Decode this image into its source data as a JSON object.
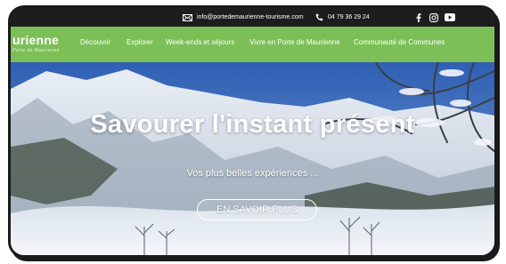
{
  "topbar": {
    "email": "info@portedemaurienne-tourisme.com",
    "phone": "04 79 36 29 24",
    "social_icons": [
      "facebook-icon",
      "instagram-icon",
      "youtube-icon"
    ],
    "background": "#1d1d1d"
  },
  "nav": {
    "logo_text": "urienne",
    "logo_subtext": "Porte de Maurienne",
    "background": "#7cbf57",
    "links": [
      "Découvrir",
      "Explorer",
      "Week-ends et séjours",
      "Vivre en Porte de Maurienne",
      "Communauté de Communes"
    ]
  },
  "hero": {
    "title": "Savourer l'instant présent",
    "subtitle": "Vos plus belles expériences ...",
    "cta_label": "EN SAVOIR PLUS"
  }
}
